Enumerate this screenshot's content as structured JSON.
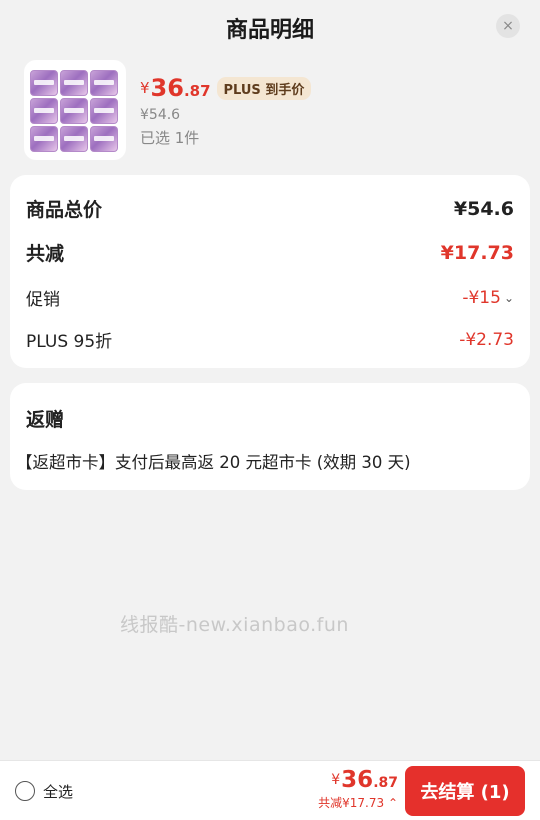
{
  "header": {
    "title": "商品明细",
    "close_icon": "×"
  },
  "product": {
    "price_currency": "¥",
    "price_int": "36",
    "price_dec": ".87",
    "plus_tag": "PLUS 到手价",
    "original_price": "¥54.6",
    "selected": "已选 1件"
  },
  "summary": {
    "total_label": "商品总价",
    "total_value": "¥54.6",
    "reduce_label": "共减",
    "reduce_value": "¥17.73",
    "promo_label": "促销",
    "promo_value": "-¥15",
    "plus_label": "PLUS 95折",
    "plus_value": "-¥2.73"
  },
  "gift": {
    "title": "返赠",
    "desc": "【返超市卡】支付后最高返 20 元超市卡 (效期 30 天)"
  },
  "watermark": "线报酷-new.xianbao.fun",
  "footer": {
    "select_all": "全选",
    "currency": "¥",
    "total_int": "36",
    "total_dec": ".87",
    "reduce_text": "共减¥17.73",
    "checkout_label": "去结算 (1)"
  },
  "colors": {
    "accent": "#e0362b",
    "checkout_bg": "#e5302c",
    "plus_tag_bg": "#f4e6d2"
  }
}
